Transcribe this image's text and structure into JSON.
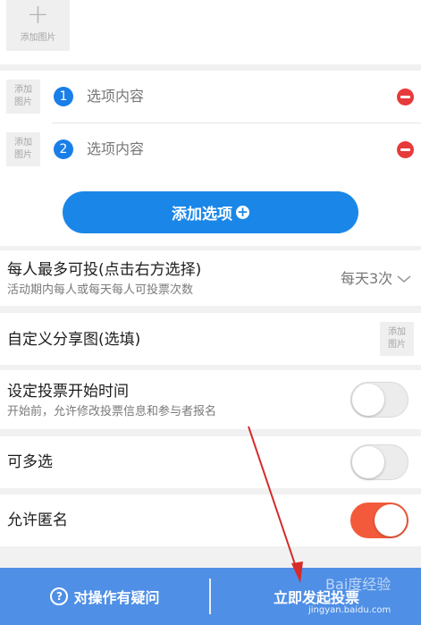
{
  "top_image": {
    "label": "添加图片"
  },
  "options": [
    {
      "number": "1",
      "placeholder": "选项内容",
      "thumb_label": "添加图片"
    },
    {
      "number": "2",
      "placeholder": "选项内容",
      "thumb_label": "添加图片"
    }
  ],
  "add_option_label": "添加选项",
  "settings": {
    "max_votes": {
      "title": "每人最多可投(点击右方选择)",
      "subtitle": "活动期内每人或每天每人可投票次数",
      "value": "每天3次"
    },
    "share_image": {
      "title": "自定义分享图(选填)",
      "thumb_label": "添加图片"
    },
    "start_time": {
      "title": "设定投票开始时间",
      "subtitle": "开始前，允许修改投票信息和参与者报名",
      "enabled": false
    },
    "multi_select": {
      "title": "可多选",
      "enabled": false
    },
    "anonymous": {
      "title": "允许匿名",
      "enabled": true
    }
  },
  "bottom_bar": {
    "help_label": "对操作有疑问",
    "publish_label": "立即发起投票"
  },
  "watermark": {
    "brand": "Bai度经验",
    "url": "jingyan.baidu.com"
  },
  "colors": {
    "accent_blue": "#1a87e8",
    "toggle_on": "#f35a3b",
    "delete_red": "#e73a3a",
    "bottom_bar": "#4f8fe6",
    "arrow": "#d62b2b"
  }
}
